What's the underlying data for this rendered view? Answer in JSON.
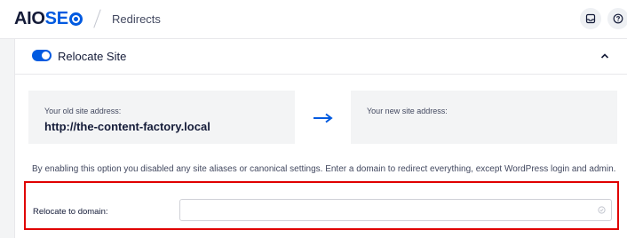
{
  "header": {
    "logo_main": "AIOSE",
    "logo_accent_letters": "SEO",
    "breadcrumb": "Redirects",
    "icons": [
      "inbox-icon",
      "help-icon"
    ]
  },
  "panel": {
    "title": "Relocate Site",
    "toggle_on": true,
    "collapse_icon": "chevron-up-icon",
    "old_address": {
      "label": "Your old site address:",
      "value": "http://the-content-factory.local"
    },
    "arrow_icon": "arrow-right-icon",
    "new_address": {
      "label": "Your new site address:",
      "value": ""
    },
    "description": "By enabling this option you disabled any site aliases or canonical settings. Enter a domain to redirect everything, except WordPress login and admin.",
    "relocate_field": {
      "label": "Relocate to domain:",
      "value": "",
      "placeholder": ""
    }
  },
  "colors": {
    "brand_blue": "#005ae0",
    "text_dark": "#141b38",
    "highlight_red": "#e00000",
    "address_box_bg": "#f3f4f5"
  }
}
